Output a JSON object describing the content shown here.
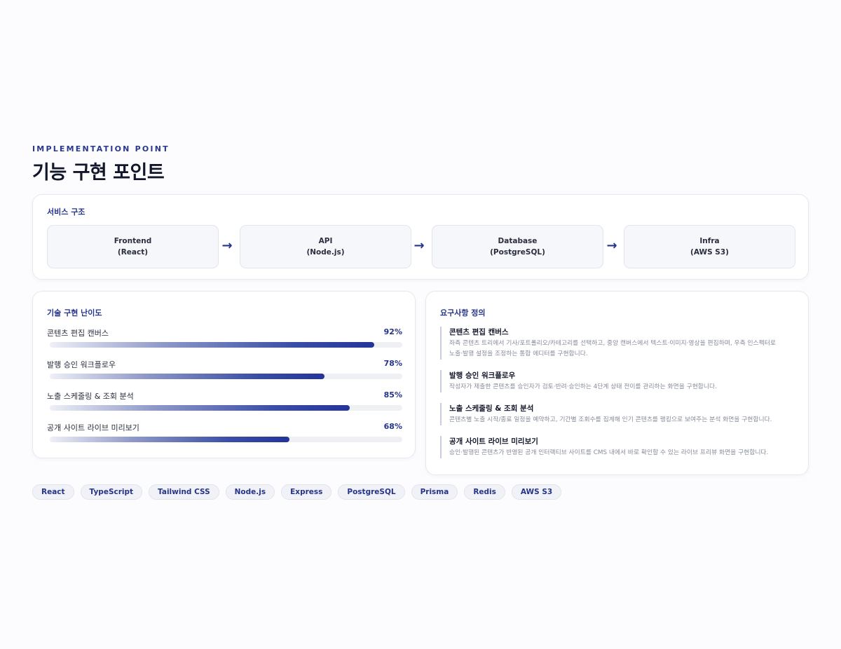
{
  "header": {
    "eyebrow": "IMPLEMENTATION POINT",
    "title": "기능 구현 포인트"
  },
  "architecture": {
    "title": "서비스 구조",
    "nodes": [
      {
        "name": "Frontend",
        "tech": "(React)"
      },
      {
        "name": "API",
        "tech": "(Node.js)"
      },
      {
        "name": "Database",
        "tech": "(PostgreSQL)"
      },
      {
        "name": "Infra",
        "tech": "(AWS S3)"
      }
    ],
    "arrow_icon": "arrow-right-icon"
  },
  "difficulty": {
    "title": "기술 구현 난이도",
    "items": [
      {
        "label": "콘텐츠 편집 캔버스",
        "value": "92%",
        "level": 0.92
      },
      {
        "label": "발행 승인 워크플로우",
        "value": "78%",
        "level": 0.78
      },
      {
        "label": "노출 스케줄링 & 조회 분석",
        "value": "85%",
        "level": 0.85
      },
      {
        "label": "공개 사이트 라이브 미리보기",
        "value": "68%",
        "level": 0.68
      }
    ]
  },
  "requirements": {
    "title": "요구사항 정의",
    "items": [
      {
        "title": "콘텐츠 편집 캔버스",
        "desc_1": "좌측 콘텐츠 트리에서 기사/포트폴리오/카테고리를 선택하고, 중앙 캔버스에서 텍스트·이미지·영상을 편집하며, 우측 인스펙터로",
        "desc_2": "노출·발행 설정을 조정하는 통합 에디터를 구현합니다."
      },
      {
        "title": "발행 승인 워크플로우",
        "desc_1": "작성자가 제출한 콘텐츠를 승인자가 검토·반려·승인하는 4단계 상태 전이를 관리하는 화면을 구현합니다.",
        "desc_2": ""
      },
      {
        "title": "노출 스케줄링 & 조회 분석",
        "desc_1": "콘텐츠별 노출 시작/종료 일정을 예약하고, 기간별 조회수를 집계해 인기 콘텐츠를 랭킹으로 보여주는 분석 화면을 구현합니다.",
        "desc_2": ""
      },
      {
        "title": "공개 사이트 라이브 미리보기",
        "desc_1": "승인·발행된 콘텐츠가 반영된 공개 인터랙티브 사이트를 CMS 내에서 바로 확인할 수 있는 라이브 프리뷰 화면을 구현합니다.",
        "desc_2": ""
      }
    ]
  },
  "tech_tags": [
    "React",
    "TypeScript",
    "Tailwind CSS",
    "Node.js",
    "Express",
    "PostgreSQL",
    "Prisma",
    "Redis",
    "AWS S3"
  ],
  "colors": {
    "accent": "#24348a",
    "background": "#fcfcfe",
    "card": "#ffffff"
  }
}
